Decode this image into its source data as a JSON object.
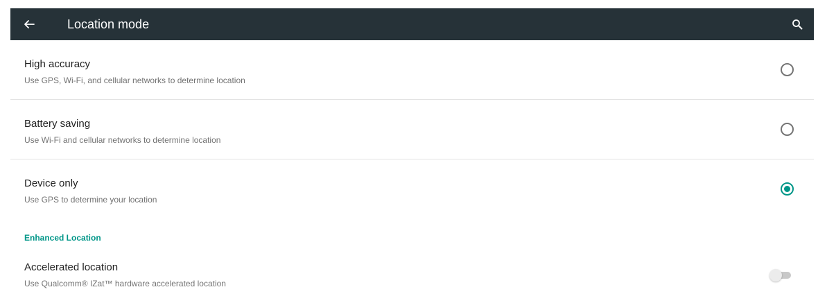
{
  "app_bar": {
    "title": "Location mode",
    "back_icon": "arrow-left-icon",
    "search_icon": "search-icon",
    "background_color": "#263238"
  },
  "modes": [
    {
      "title": "High accuracy",
      "summary": "Use GPS, Wi-Fi, and cellular networks to determine location",
      "selected": false
    },
    {
      "title": "Battery saving",
      "summary": "Use Wi-Fi and cellular networks to determine location",
      "selected": false
    },
    {
      "title": "Device only",
      "summary": "Use GPS to determine your location",
      "selected": true
    }
  ],
  "enhanced": {
    "header": "Enhanced Location",
    "accelerated": {
      "title": "Accelerated location",
      "summary": "Use Qualcomm® IZat™ hardware accelerated location",
      "enabled": false
    }
  },
  "colors": {
    "accent": "#009688",
    "text_primary": "#212121",
    "text_secondary": "#737373"
  }
}
